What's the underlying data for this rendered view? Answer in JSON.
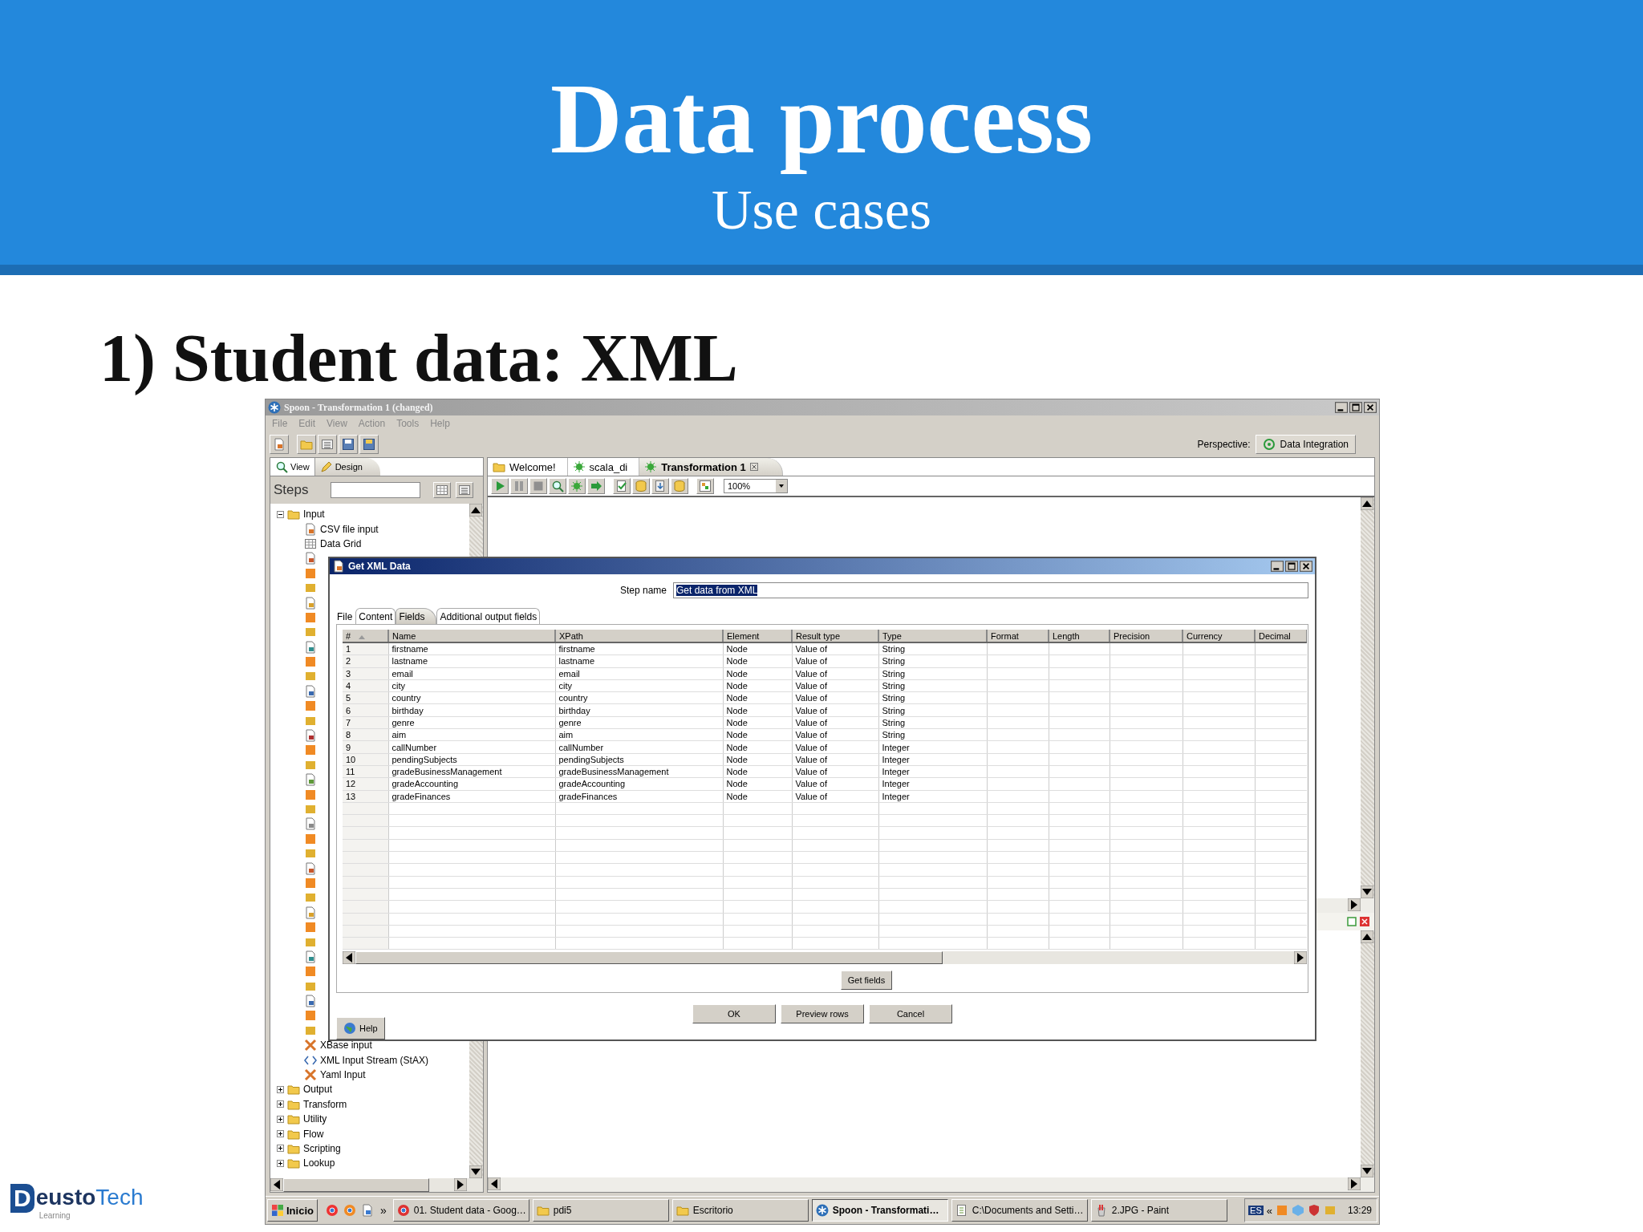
{
  "slide": {
    "title": "Data process",
    "subtitle": "Use cases",
    "heading": "1) Student data: XML"
  },
  "window": {
    "title": "Spoon - Transformation 1 (changed)",
    "menu": [
      "File",
      "Edit",
      "View",
      "Action",
      "Tools",
      "Help"
    ],
    "perspective": {
      "label": "Perspective:",
      "value": "Data Integration"
    },
    "side_tabs": [
      {
        "label": "View",
        "selected": false
      },
      {
        "label": "Design",
        "selected": true
      }
    ],
    "steps_label": "Steps",
    "tree": [
      {
        "label": "Input",
        "expanded": true,
        "children": [
          {
            "kind": "step",
            "label": "CSV file input"
          },
          {
            "kind": "step",
            "label": "Data Grid"
          },
          {
            "kind": "covered"
          },
          {
            "kind": "step",
            "label": "XBase input"
          },
          {
            "kind": "step",
            "label": "XML Input Stream (StAX)"
          },
          {
            "kind": "step",
            "label": "Yaml Input"
          }
        ]
      },
      {
        "label": "Output",
        "expanded": false
      },
      {
        "label": "Transform",
        "expanded": false
      },
      {
        "label": "Utility",
        "expanded": false
      },
      {
        "label": "Flow",
        "expanded": false
      },
      {
        "label": "Scripting",
        "expanded": false
      },
      {
        "label": "Lookup",
        "expanded": false
      }
    ],
    "editor_tabs": [
      {
        "label": "Welcome!",
        "selected": false
      },
      {
        "label": "scala_di",
        "selected": false
      },
      {
        "label": "Transformation 1",
        "selected": true
      }
    ],
    "zoom": "100%"
  },
  "dialog": {
    "title": "Get XML Data",
    "step_name": {
      "label": "Step name",
      "value": "Get data from XML",
      "highlighted": true
    },
    "tabs": [
      {
        "label": "File",
        "selected": false
      },
      {
        "label": "Content",
        "selected": false
      },
      {
        "label": "Fields",
        "selected": true
      },
      {
        "label": "Additional output fields",
        "selected": false
      }
    ],
    "table": {
      "columns": [
        "#",
        "Name",
        "XPath",
        "Element",
        "Result type",
        "Type",
        "Format",
        "Length",
        "Precision",
        "Currency",
        "Decimal"
      ],
      "rows": [
        [
          "1",
          "firstname",
          "firstname",
          "Node",
          "Value of",
          "String"
        ],
        [
          "2",
          "lastname",
          "lastname",
          "Node",
          "Value of",
          "String"
        ],
        [
          "3",
          "email",
          "email",
          "Node",
          "Value of",
          "String"
        ],
        [
          "4",
          "city",
          "city",
          "Node",
          "Value of",
          "String"
        ],
        [
          "5",
          "country",
          "country",
          "Node",
          "Value of",
          "String"
        ],
        [
          "6",
          "birthday",
          "birthday",
          "Node",
          "Value of",
          "String"
        ],
        [
          "7",
          "genre",
          "genre",
          "Node",
          "Value of",
          "String"
        ],
        [
          "8",
          "aim",
          "aim",
          "Node",
          "Value of",
          "String"
        ],
        [
          "9",
          "callNumber",
          "callNumber",
          "Node",
          "Value of",
          "Integer"
        ],
        [
          "10",
          "pendingSubjects",
          "pendingSubjects",
          "Node",
          "Value of",
          "Integer"
        ],
        [
          "11",
          "gradeBusinessManagement",
          "gradeBusinessManagement",
          "Node",
          "Value of",
          "Integer"
        ],
        [
          "12",
          "gradeAccounting",
          "gradeAccounting",
          "Node",
          "Value of",
          "Integer"
        ],
        [
          "13",
          "gradeFinances",
          "gradeFinances",
          "Node",
          "Value of",
          "Integer"
        ]
      ]
    },
    "get_fields": "Get fields",
    "buttons": [
      "OK",
      "Preview rows",
      "Cancel"
    ],
    "help": "Help"
  },
  "taskbar": {
    "start": "Inicio",
    "overflow": "»",
    "tasks": [
      {
        "kind": "browser",
        "label": "01. Student data - Goog…",
        "selected": false
      },
      {
        "kind": "folder",
        "label": "pdi5",
        "selected": false
      },
      {
        "kind": "folder",
        "label": "Escritorio",
        "selected": false
      },
      {
        "kind": "app",
        "label": "Spoon - Transformati…",
        "selected": true
      },
      {
        "kind": "notepad",
        "label": "C:\\Documents and Setti…",
        "selected": false
      },
      {
        "kind": "paint",
        "label": "2.JPG - Paint",
        "selected": false
      }
    ],
    "language": "ES",
    "tray_toggle": "«",
    "clock": "13:29"
  },
  "logo": {
    "mark": "D",
    "name": "eusto",
    "accent": "Tech",
    "tagline": "Learning"
  }
}
